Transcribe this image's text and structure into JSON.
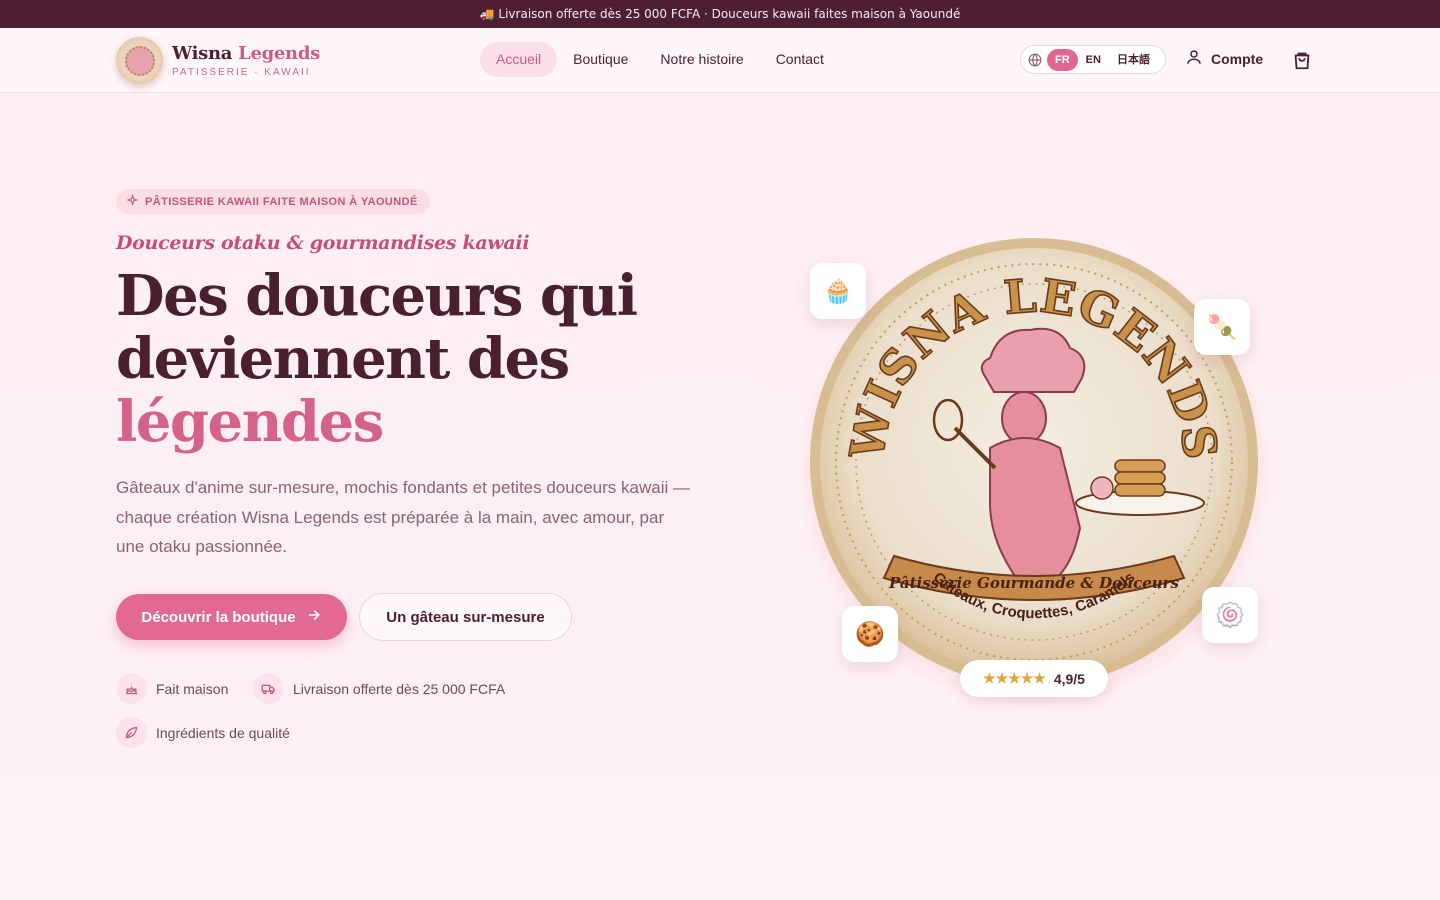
{
  "announcement": "🚚 Livraison offerte dès 25 000 FCFA · Douceurs kawaii faites maison à Yaoundé",
  "brand": {
    "name_part1": "Wisna ",
    "name_part2": "Legends",
    "tagline": "PATISSERIE · KAWAII"
  },
  "nav": {
    "items": [
      {
        "label": "Accueil",
        "active": true
      },
      {
        "label": "Boutique",
        "active": false
      },
      {
        "label": "Notre histoire",
        "active": false
      },
      {
        "label": "Contact",
        "active": false
      }
    ]
  },
  "languages": {
    "options": [
      "FR",
      "EN",
      "日本語"
    ],
    "selected": "FR"
  },
  "account_label": "Compte",
  "hero": {
    "badge": "PÂTISSERIE KAWAII FAITE MAISON À YAOUNDÉ",
    "script_line": "Douceurs otaku & gourmandises kawaii",
    "headline_line1": "Des douceurs qui",
    "headline_line2": "deviennent des",
    "headline_accent": "légendes",
    "description": "Gâteaux d'anime sur-mesure, mochis fondants et petites douceurs kawaii — chaque création Wisna Legends est préparée à la main, avec amour, par une otaku passionnée.",
    "cta_primary": "Découvrir la boutique",
    "cta_secondary": "Un gâteau sur-mesure",
    "features": [
      "Fait maison",
      "Livraison offerte dès 25 000 FCFA",
      "Ingrédients de qualité"
    ]
  },
  "seal": {
    "title": "WISNA LEGENDS",
    "ribbon": "Pâtisserie Gourmande & Douceurs",
    "bottom": "Gâteaux, Croquettes, Caramels"
  },
  "floating_icons": [
    "cupcake-icon",
    "dango-icon",
    "cookie-icon",
    "candy-icon"
  ],
  "rating": {
    "value": "4,9/5",
    "stars": 5
  },
  "colors": {
    "primary": "#e26a91",
    "dark": "#4e1f33",
    "accent": "#d4628a",
    "star": "#e0a43a"
  }
}
